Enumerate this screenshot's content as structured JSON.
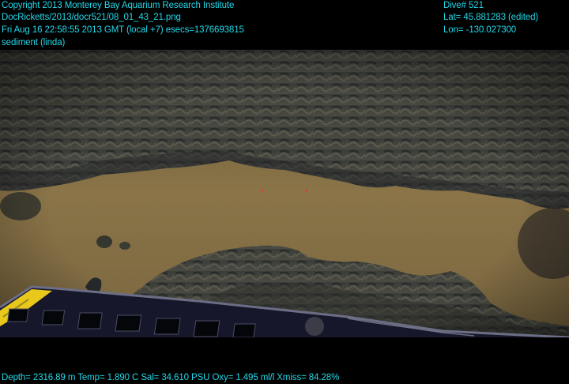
{
  "overlay": {
    "copyright": "Copyright 2013 Monterey Bay Aquarium Research Institute",
    "filename": "DocRicketts/2013/docr521/08_01_43_21.png",
    "timestamp": "Fri Aug 16 22:58:55 2013 GMT (local +7)  esecs=1376693815",
    "annotation": "sediment (linda)",
    "dive": "Dive# 521",
    "lat": "Lat= 45.881283 (edited)",
    "lon": "Lon= -130.027300",
    "sensors": "Depth= 2316.89 m  Temp= 1.890 C  Sal= 34.610 PSU  Oxy= 1.495 ml/l  Xmiss= 84.28%"
  },
  "colors": {
    "overlay_text": "#22d8e8",
    "background": "#000000",
    "sediment": "#8a7448",
    "rock": "#3a3d38",
    "vehicle_frame": "#1a1a2a",
    "vehicle_yellow": "#e8c81a"
  }
}
